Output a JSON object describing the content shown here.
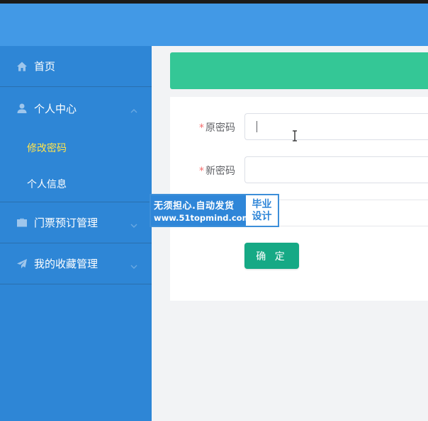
{
  "sidebar": {
    "items": [
      {
        "label": "首页",
        "icon": "home-icon"
      },
      {
        "label": "个人中心",
        "icon": "user-icon",
        "expanded": true,
        "children": [
          {
            "label": "修改密码",
            "active": true
          },
          {
            "label": "个人信息",
            "active": false
          }
        ]
      },
      {
        "label": "门票预订管理",
        "icon": "briefcase-icon",
        "expanded": false
      },
      {
        "label": "我的收藏管理",
        "icon": "paper-plane-icon",
        "expanded": false
      }
    ]
  },
  "form": {
    "old_password": {
      "label": "原密码",
      "required": true,
      "value": ""
    },
    "new_password": {
      "label": "新密码",
      "required": true,
      "value": ""
    },
    "submit_label": "确 定"
  },
  "watermark": {
    "line1": "无须担心.自动发货",
    "line2": "www.51topmind.com",
    "right1": "毕业",
    "right2": "设计"
  },
  "colors": {
    "header": "#4299e6",
    "sidebar": "#2e86d6",
    "active_menu_text": "#ffe44d",
    "banner": "#34c796",
    "submit_button": "#16a985",
    "required_mark": "#f56c6c"
  }
}
